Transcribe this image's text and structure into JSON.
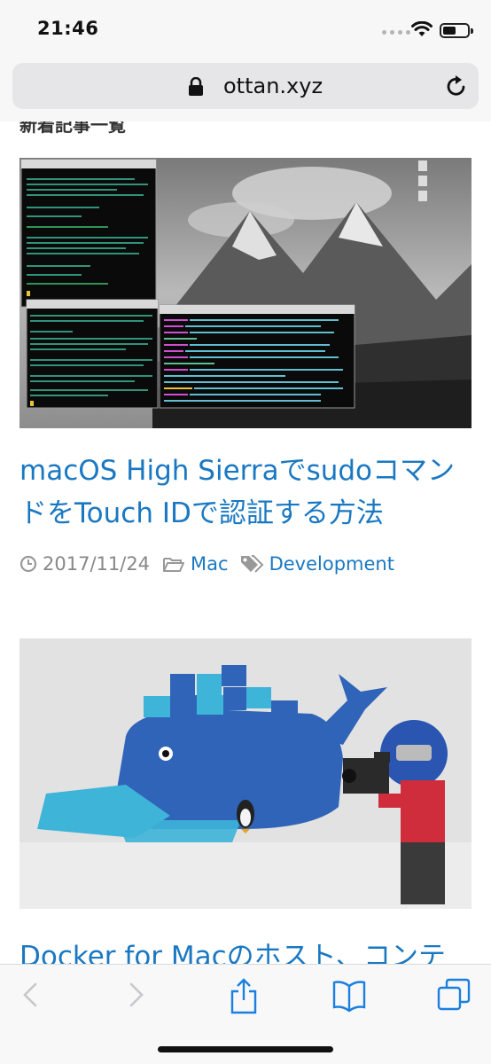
{
  "status": {
    "time": "21:46"
  },
  "address": {
    "url": "ottan.xyz"
  },
  "page": {
    "section_title": "新着記事一覧",
    "articles": [
      {
        "title_line1": "macOS High Sierraでsudoコマン",
        "title_line2": "ドをTouch IDで認証する方法",
        "date": "2017/11/24",
        "category": "Mac",
        "tag": "Development"
      },
      {
        "title_line1": "Docker for Macのホスト、コンテナ"
      }
    ]
  },
  "colors": {
    "link": "#1a78c2",
    "meta_gray": "#888888",
    "toolbar_blue": "#1a7fe0"
  },
  "icons": [
    "lock-icon",
    "reload-icon",
    "clock-icon",
    "folder-icon",
    "tags-icon",
    "back-icon",
    "forward-icon",
    "share-icon",
    "bookmarks-icon",
    "tabs-icon"
  ]
}
